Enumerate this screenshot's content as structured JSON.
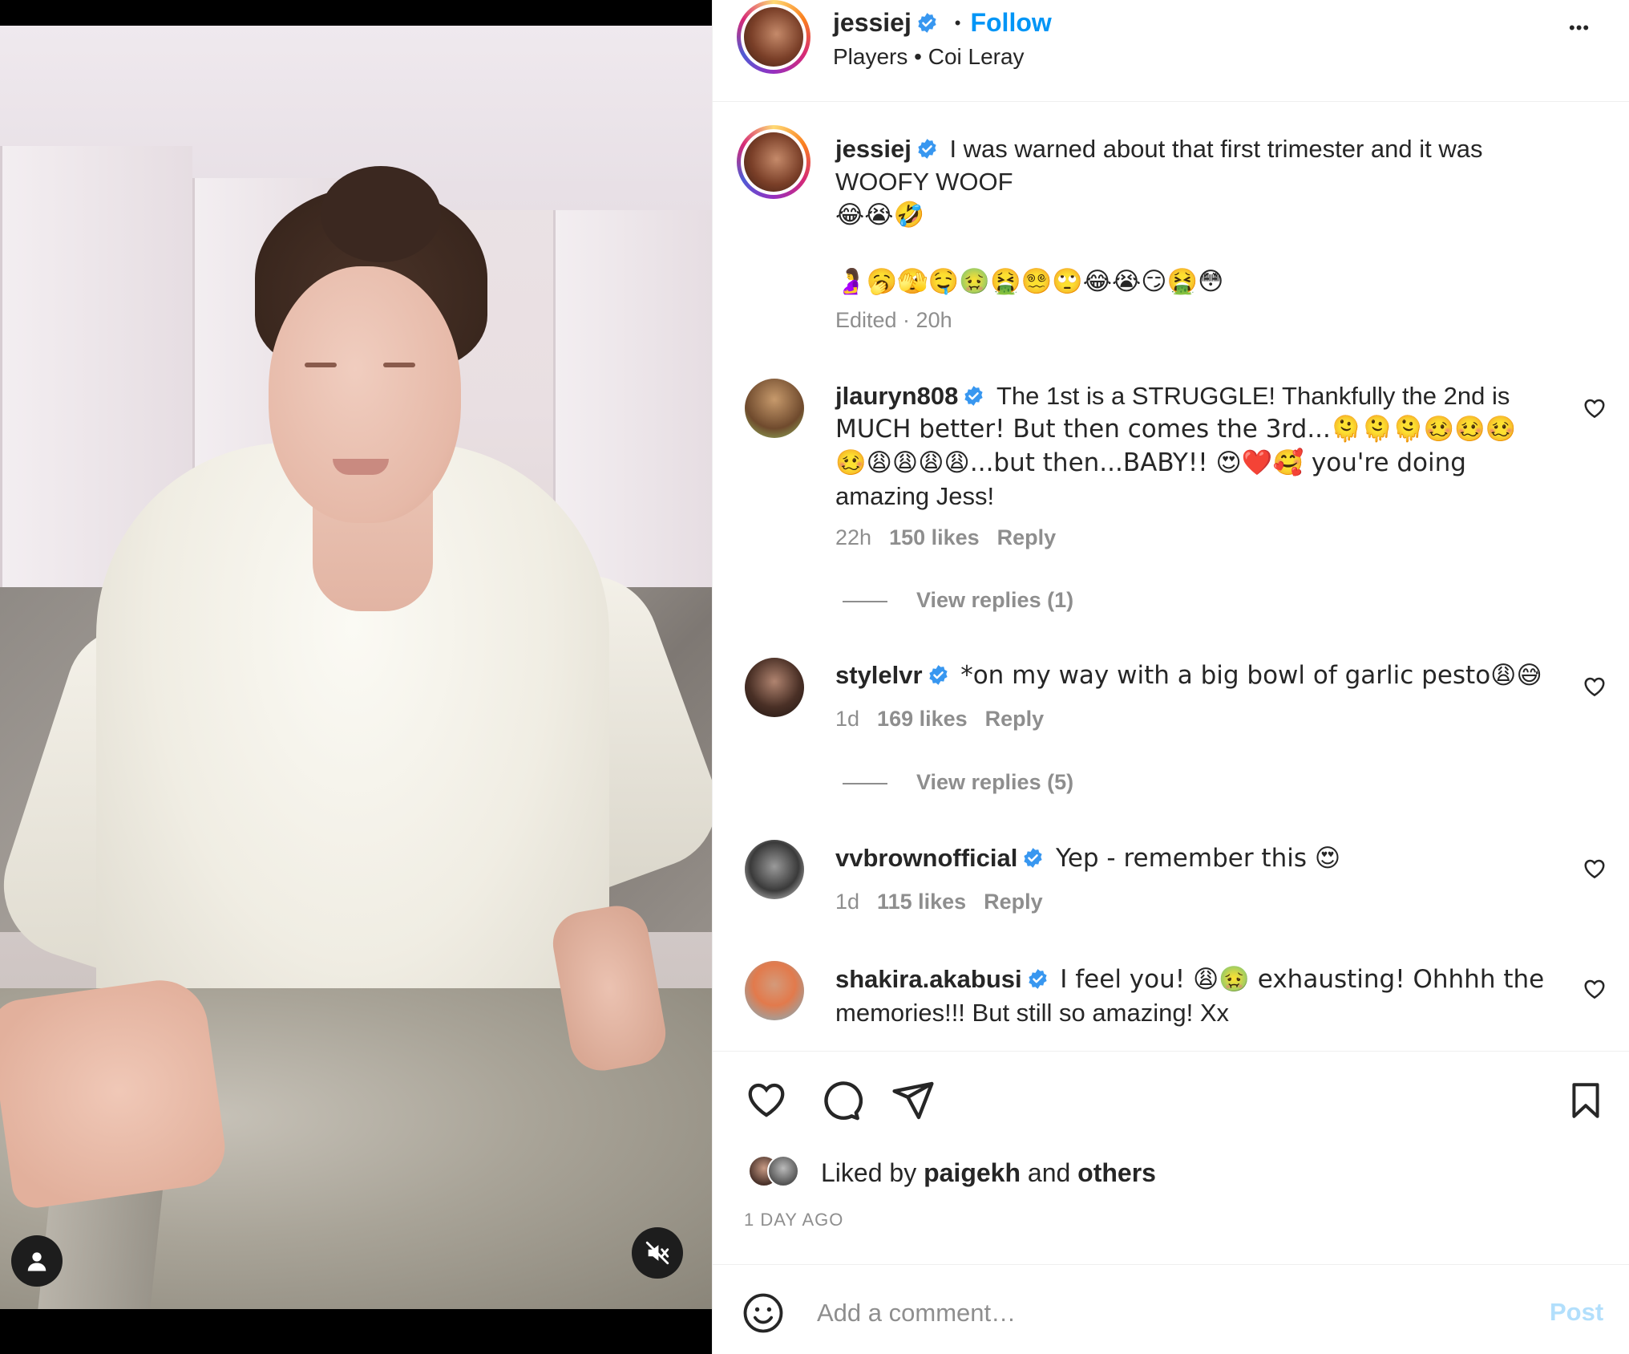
{
  "post": {
    "author": "jessiej",
    "follow_label": "Follow",
    "dot": "•",
    "audio": "Players • Coi Leray",
    "more_label": "•••"
  },
  "caption": {
    "author": "jessiej",
    "line1": "I was warned about that first trimester and it was",
    "line2": "WOOFY WOOF",
    "emoji_line1": "😂😭🤣",
    "emoji_line2": "🤰🥱🫣🤤🤢🤮😵‍💫🙄😂😭😏🤮😳",
    "edited": "Edited · 20h"
  },
  "comments": [
    {
      "author": "jlauryn808",
      "line1": "The 1st is a STRUGGLE! Thankfully the 2nd is",
      "line2": "MUCH better! But then comes the 3rd...🫠🫠🫠🥴🥴🥴",
      "line3": "🥴😩😩😩😩...but then...BABY!! 😍❤️🥰 you're doing",
      "line4": "amazing Jess!",
      "time": "22h",
      "likes": "150 likes",
      "reply": "Reply",
      "view_replies": "View replies (1)"
    },
    {
      "author": "stylelvr",
      "line1": "*on my way with a big bowl of garlic pesto😩😅",
      "time": "1d",
      "likes": "169 likes",
      "reply": "Reply",
      "view_replies": "View replies (5)"
    },
    {
      "author": "vvbrownofficial",
      "line1": "Yep - remember this 😍",
      "time": "1d",
      "likes": "115 likes",
      "reply": "Reply"
    },
    {
      "author": "shakira.akabusi",
      "line1": "I feel you! 😩🤢 exhausting! Ohhhh the",
      "line2": "memories!!! But still so amazing! Xx"
    }
  ],
  "likes_row": {
    "liked_by": "Liked by",
    "user": "paigekh",
    "and": "and",
    "others": "others"
  },
  "timestamp": "1 DAY AGO",
  "comment_box": {
    "placeholder": "Add a comment…",
    "post_label": "Post"
  },
  "colors": {
    "link_blue": "#0095f6",
    "post_disabled": "#b2dffc",
    "muted": "#8e8e8e"
  },
  "icons": {
    "like": "heart-icon",
    "comment": "comment-bubble-icon",
    "share": "paper-plane-icon",
    "save": "bookmark-icon",
    "emoji": "smiley-icon",
    "mute": "speaker-muted-icon",
    "user_tag": "person-icon"
  }
}
